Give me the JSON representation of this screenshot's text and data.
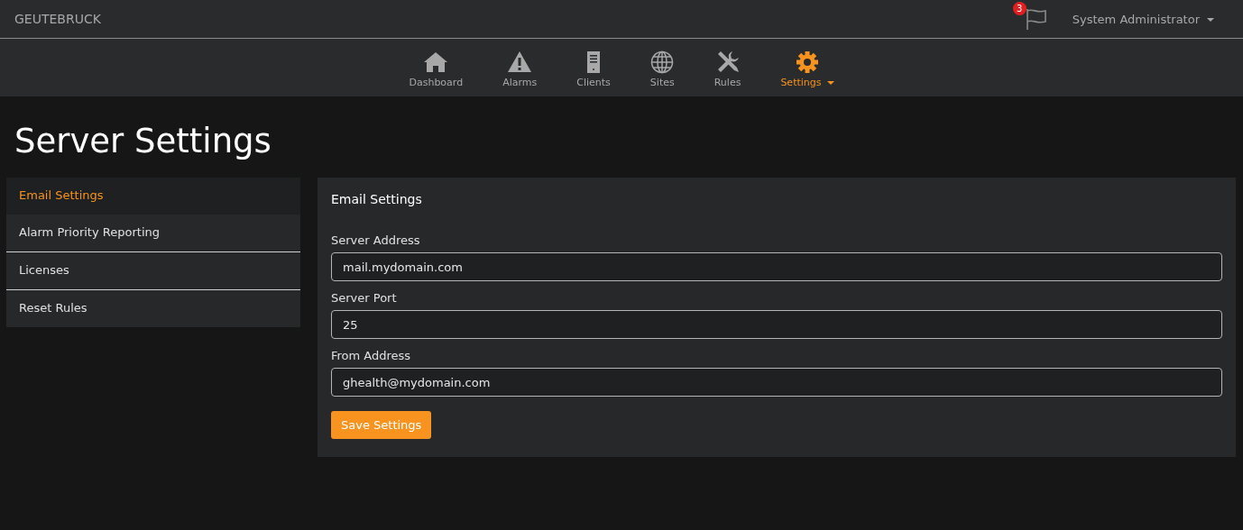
{
  "brand": "GEUTEBRUCK",
  "notifications": {
    "count": "3"
  },
  "user": {
    "name": "System Administrator"
  },
  "nav": [
    {
      "kind": "home",
      "label": "Dashboard",
      "selected": false,
      "dropdown": false
    },
    {
      "kind": "warning",
      "label": "Alarms",
      "selected": false,
      "dropdown": false
    },
    {
      "kind": "server",
      "label": "Clients",
      "selected": false,
      "dropdown": false
    },
    {
      "kind": "globe",
      "label": "Sites",
      "selected": false,
      "dropdown": false
    },
    {
      "kind": "tools",
      "label": "Rules",
      "selected": false,
      "dropdown": false
    },
    {
      "kind": "gear",
      "label": "Settings",
      "selected": true,
      "dropdown": true
    }
  ],
  "page_title": "Server Settings",
  "sidebar": {
    "items": [
      {
        "label": "Email Settings",
        "selected": true
      },
      {
        "label": "Alarm Priority Reporting",
        "selected": false
      },
      {
        "label": "Licenses",
        "selected": false
      },
      {
        "label": "Reset Rules",
        "selected": false
      }
    ]
  },
  "panel": {
    "title": "Email Settings",
    "fields": [
      {
        "label": "Server Address",
        "value": "mail.mydomain.com"
      },
      {
        "label": "Server Port",
        "value": "25"
      },
      {
        "label": "From Address",
        "value": "ghealth@mydomain.com"
      }
    ],
    "button": "Save Settings"
  }
}
